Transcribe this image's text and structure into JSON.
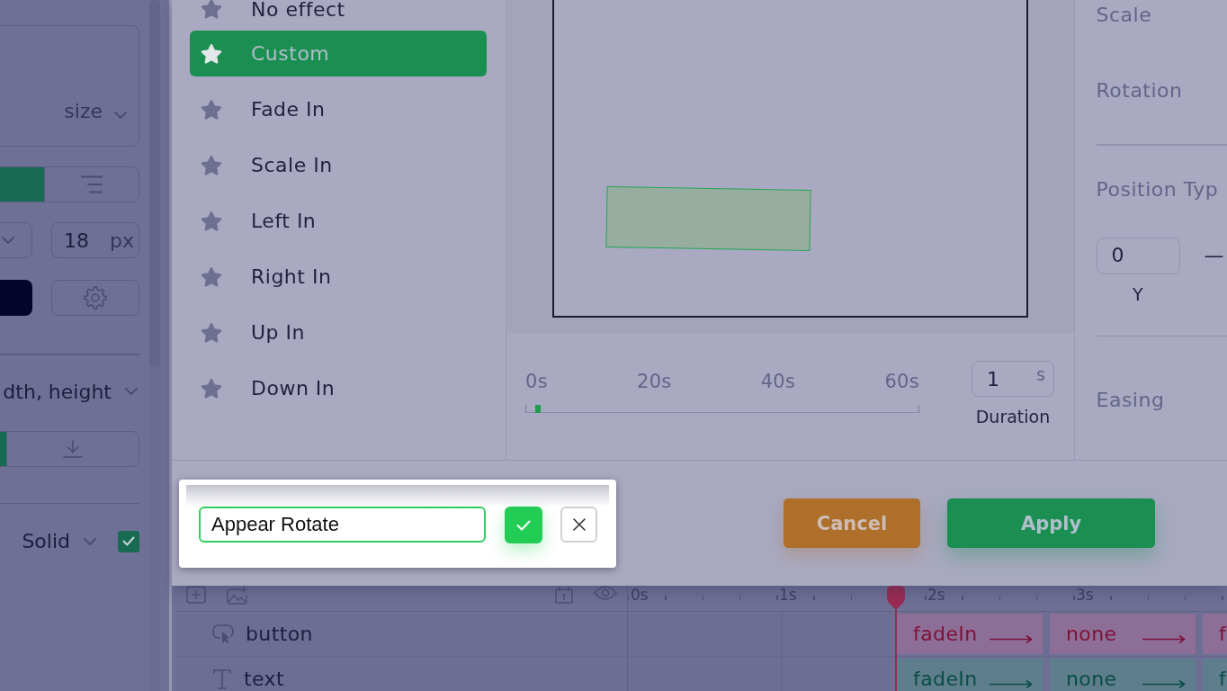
{
  "sidebar": {
    "font_dropdown": {
      "value": "size"
    },
    "alignment": [
      {
        "selected": true
      },
      {
        "selected": false
      }
    ],
    "font_size": {
      "value": "18",
      "unit": "px"
    },
    "size_mode": {
      "value": "dth, height"
    },
    "download_options": [
      {
        "selected": true
      },
      {
        "selected": false
      }
    ],
    "border": {
      "style": "Solid",
      "checked": true
    }
  },
  "effects": {
    "items": [
      {
        "label": "No effect",
        "selected": false
      },
      {
        "label": "Custom",
        "selected": true
      },
      {
        "label": "Fade In",
        "selected": false
      },
      {
        "label": "Scale In",
        "selected": false
      },
      {
        "label": "Left In",
        "selected": false
      },
      {
        "label": "Right In",
        "selected": false
      },
      {
        "label": "Up In",
        "selected": false
      },
      {
        "label": "Down In",
        "selected": false
      }
    ]
  },
  "scrubber": {
    "ticks": [
      "0s",
      "20s",
      "40s",
      "60s"
    ],
    "level": 0.03
  },
  "duration": {
    "value": "1",
    "unit": "s",
    "label": "Duration"
  },
  "properties": {
    "scale_label": "Scale",
    "rotation_label": "Rotation",
    "position_label": "Position Typ",
    "position": {
      "value": "0",
      "label": "Y",
      "separator": "—"
    },
    "easing_label": "Easing"
  },
  "footer": {
    "buttons": [
      {
        "label": "Cancel",
        "kind": "cancel"
      },
      {
        "label": "Apply",
        "kind": "apply"
      }
    ]
  },
  "name_popup": {
    "value": "Appear Rotate"
  },
  "timeline": {
    "ruler": [
      "0s",
      "1s",
      "2s",
      "3s"
    ],
    "playhead": {
      "level": 0.447
    },
    "layers": [
      {
        "name": "button",
        "kind": "button",
        "clips": [
          {
            "label": "fadeIn",
            "arrow": true
          },
          {
            "label": "none",
            "arrow": true
          },
          {
            "label": "f",
            "arrow": false
          }
        ]
      },
      {
        "name": "text",
        "kind": "text",
        "clips": [
          {
            "label": "fadeIn",
            "arrow": true
          },
          {
            "label": "none",
            "arrow": true
          },
          {
            "label": "f",
            "arrow": false
          }
        ]
      }
    ]
  }
}
